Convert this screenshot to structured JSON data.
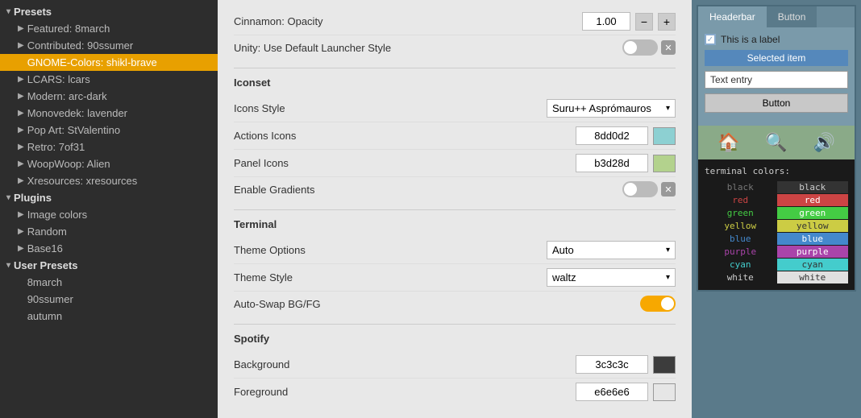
{
  "sidebar": {
    "sections": [
      {
        "label": "Presets",
        "expanded": true,
        "items": [
          {
            "label": "Featured: 8march",
            "hasArrow": true,
            "active": false
          },
          {
            "label": "Contributed: 90ssumer",
            "hasArrow": true,
            "active": false
          },
          {
            "label": "GNOME-Colors: shikl-brave",
            "hasArrow": false,
            "active": true
          },
          {
            "label": "LCARS: lcars",
            "hasArrow": true,
            "active": false
          },
          {
            "label": "Modern: arc-dark",
            "hasArrow": true,
            "active": false
          },
          {
            "label": "Monovedek: lavender",
            "hasArrow": true,
            "active": false
          },
          {
            "label": "Pop Art: StValentino",
            "hasArrow": true,
            "active": false
          },
          {
            "label": "Retro: 7of31",
            "hasArrow": true,
            "active": false
          },
          {
            "label": "WoopWoop: Alien",
            "hasArrow": true,
            "active": false
          },
          {
            "label": "Xresources: xresources",
            "hasArrow": true,
            "active": false
          }
        ]
      },
      {
        "label": "Plugins",
        "expanded": true,
        "items": [
          {
            "label": "Image colors",
            "hasArrow": true,
            "active": false
          },
          {
            "label": "Random",
            "hasArrow": true,
            "active": false
          },
          {
            "label": "Base16",
            "hasArrow": true,
            "active": false
          }
        ]
      },
      {
        "label": "User Presets",
        "expanded": true,
        "items": [
          {
            "label": "8march",
            "hasArrow": false,
            "active": false
          },
          {
            "label": "90ssumer",
            "hasArrow": false,
            "active": false
          },
          {
            "label": "autumn",
            "hasArrow": false,
            "active": false
          }
        ]
      }
    ]
  },
  "main": {
    "sections": [
      {
        "id": "cinnamon",
        "rows": [
          {
            "label": "Cinnamon: Opacity",
            "type": "number",
            "value": "1.00"
          },
          {
            "label": "Unity: Use Default Launcher Style",
            "type": "toggle",
            "on": false,
            "hasX": true
          }
        ]
      },
      {
        "id": "iconset",
        "title": "Iconset",
        "rows": [
          {
            "label": "Icons Style",
            "type": "dropdown",
            "value": "Suru++ Asprómauros"
          },
          {
            "label": "Actions Icons",
            "type": "color",
            "hex": "8dd0d2",
            "swatch": "#8dd0d2"
          },
          {
            "label": "Panel Icons",
            "type": "color",
            "hex": "b3d28d",
            "swatch": "#b3d28d"
          },
          {
            "label": "Enable Gradients",
            "type": "toggle",
            "on": false,
            "hasX": true
          }
        ]
      },
      {
        "id": "terminal",
        "title": "Terminal",
        "rows": [
          {
            "label": "Theme Options",
            "type": "dropdown",
            "value": "Auto"
          },
          {
            "label": "Theme Style",
            "type": "dropdown",
            "value": "waltz"
          },
          {
            "label": "Auto-Swap BG/FG",
            "type": "toggle",
            "on": true,
            "hasX": false
          }
        ]
      },
      {
        "id": "spotify",
        "title": "Spotify",
        "rows": [
          {
            "label": "Background",
            "type": "color",
            "hex": "3c3c3c",
            "swatch": "#3c3c3c"
          },
          {
            "label": "Foreground",
            "type": "color",
            "hex": "e6e6e6",
            "swatch": "#e6e6e6"
          }
        ]
      }
    ]
  },
  "preview": {
    "tabs": [
      "Headerbar",
      "Button"
    ],
    "activeTab": "Headerbar",
    "checkboxLabel": "This is a label",
    "selectedItem": "Selected item",
    "textEntry": "Text entry",
    "buttonLabel": "Button",
    "icons": [
      "🏠",
      "🔍",
      "🔊"
    ],
    "terminal": {
      "title": "terminal colors:",
      "colors": [
        {
          "name": "black",
          "normal_bg": "#1a1a1a",
          "normal_fg": "#888",
          "bright_bg": "#333",
          "bright_fg": "#ccc"
        },
        {
          "name": "red",
          "normal_bg": "#1a1a1a",
          "normal_fg": "#cc4444",
          "bright_bg": "#cc4444",
          "bright_fg": "#fff"
        },
        {
          "name": "green",
          "normal_bg": "#1a1a1a",
          "normal_fg": "#44cc44",
          "bright_bg": "#44cc44",
          "bright_fg": "#fff"
        },
        {
          "name": "yellow",
          "normal_bg": "#1a1a1a",
          "normal_fg": "#cccc44",
          "bright_bg": "#cccc44",
          "bright_fg": "#333"
        },
        {
          "name": "blue",
          "normal_bg": "#1a1a1a",
          "normal_fg": "#4488cc",
          "bright_bg": "#4488cc",
          "bright_fg": "#fff"
        },
        {
          "name": "purple",
          "normal_bg": "#1a1a1a",
          "normal_fg": "#aa44aa",
          "bright_bg": "#aa44aa",
          "bright_fg": "#fff"
        },
        {
          "name": "cyan",
          "normal_bg": "#1a1a1a",
          "normal_fg": "#44cccc",
          "bright_bg": "#44cccc",
          "bright_fg": "#333"
        },
        {
          "name": "white",
          "normal_bg": "#1a1a1a",
          "normal_fg": "#ccc",
          "bright_bg": "#e8e8e8",
          "bright_fg": "#333"
        }
      ]
    }
  }
}
